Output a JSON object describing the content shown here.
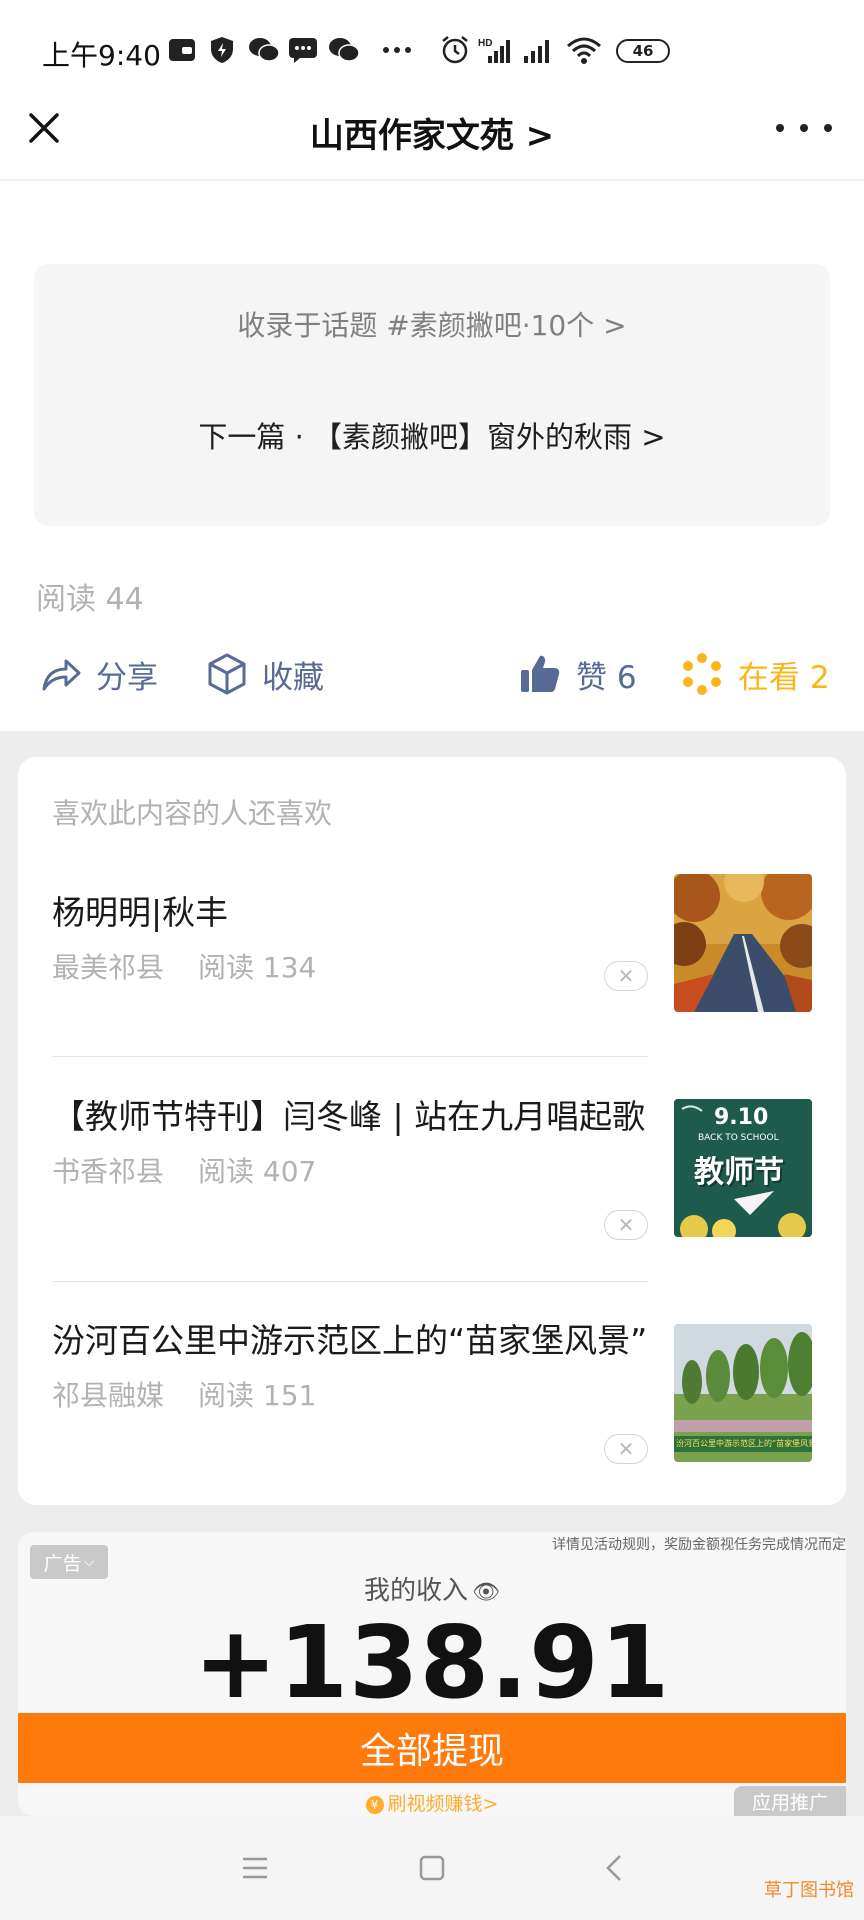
{
  "status_bar": {
    "time": "上午9:40",
    "battery": "46"
  },
  "nav": {
    "title": "山西作家文苑 >"
  },
  "article": {
    "topic_link": "收录于话题 #素颜撇吧·10个 >",
    "next_link": "下一篇 · 【素颜撇吧】窗外的秋雨  >",
    "read_count": "阅读 44",
    "actions": {
      "share": "分享",
      "favorite": "收藏",
      "like": "赞 6",
      "looking": "在看 2"
    }
  },
  "recommendations": {
    "heading": "喜欢此内容的人还喜欢",
    "items": [
      {
        "title": "杨明明|秋丰",
        "source": "最美祁县",
        "reads": "阅读 134",
        "thumb_icon": "autumn-road-photo"
      },
      {
        "title": "【教师节特刊】闫冬峰 | 站在九月唱起歌",
        "source": "书香祁县",
        "reads": "阅读 407",
        "thumb_icon": "teachers-day-poster",
        "thumb_text_top": "9.10",
        "thumb_text_sub": "BACK TO SCHOOL",
        "thumb_text_main": "教师节"
      },
      {
        "title": "汾河百公里中游示范区上的“苗家堡风景”",
        "source": "祁县融媒",
        "reads": "阅读 151",
        "thumb_icon": "riverside-trees-photo",
        "thumb_caption": "汾河百公里中游示范区上的“苗家堡风景”"
      }
    ]
  },
  "ad": {
    "tag": "广告",
    "note": "详情见活动规则，奖励金额视任务完成情况而定",
    "income_label": "我的收入",
    "amount": "+138.91",
    "cta": "全部提现",
    "sub": "刷视频赚钱>",
    "app_promo": "应用推广"
  },
  "watermark": "草丁图书馆",
  "colors": {
    "link_blue": "#576b95",
    "looking_yellow": "#fbb518",
    "cta_orange": "#ff7a0d"
  }
}
